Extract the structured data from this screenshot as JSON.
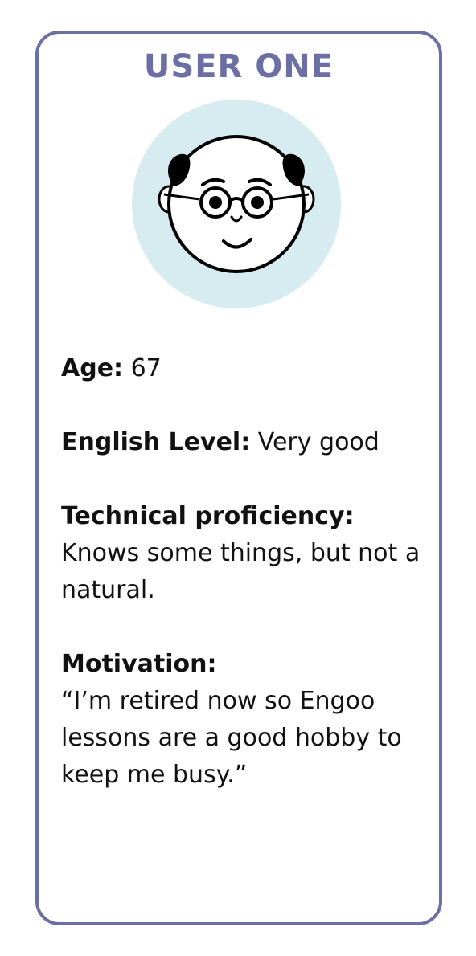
{
  "card": {
    "title": "USER ONE",
    "avatar_icon": "bald-man-with-glasses-icon",
    "colors": {
      "border": "#6b6fa3",
      "title": "#6b6fa3",
      "avatar_bg": "#d6ecf0"
    },
    "fields": {
      "age": {
        "label": "Age:",
        "value": "67"
      },
      "english": {
        "label": "English Level:",
        "value": "Very good"
      },
      "technical": {
        "label": "Technical proficiency:",
        "value": "Knows some things, but not a natural."
      },
      "motivation": {
        "label": "Motivation:",
        "value": "“I’m retired now so Engoo lessons are a good hobby to keep me busy.”"
      }
    }
  }
}
